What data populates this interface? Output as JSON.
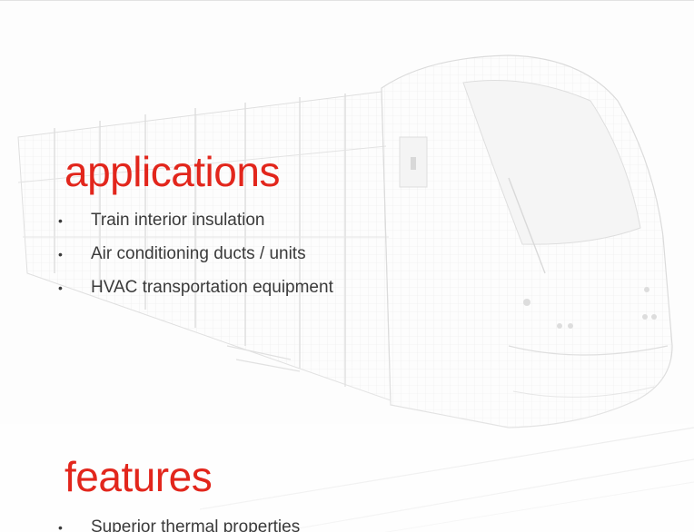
{
  "applications": {
    "title": "applications",
    "items": [
      "Train interior insulation",
      "Air conditioning ducts / units",
      "HVAC transportation equipment"
    ]
  },
  "features": {
    "title": "features",
    "items": [
      "Superior thermal properties"
    ]
  },
  "colors": {
    "accent": "#e2261c",
    "body_text": "#3a3a3a",
    "illustration_line": "#c8c8c8",
    "background": "#fdfdfd"
  },
  "icons": {
    "bullet": "bullet-icon",
    "background": "train-wireframe-illustration"
  }
}
